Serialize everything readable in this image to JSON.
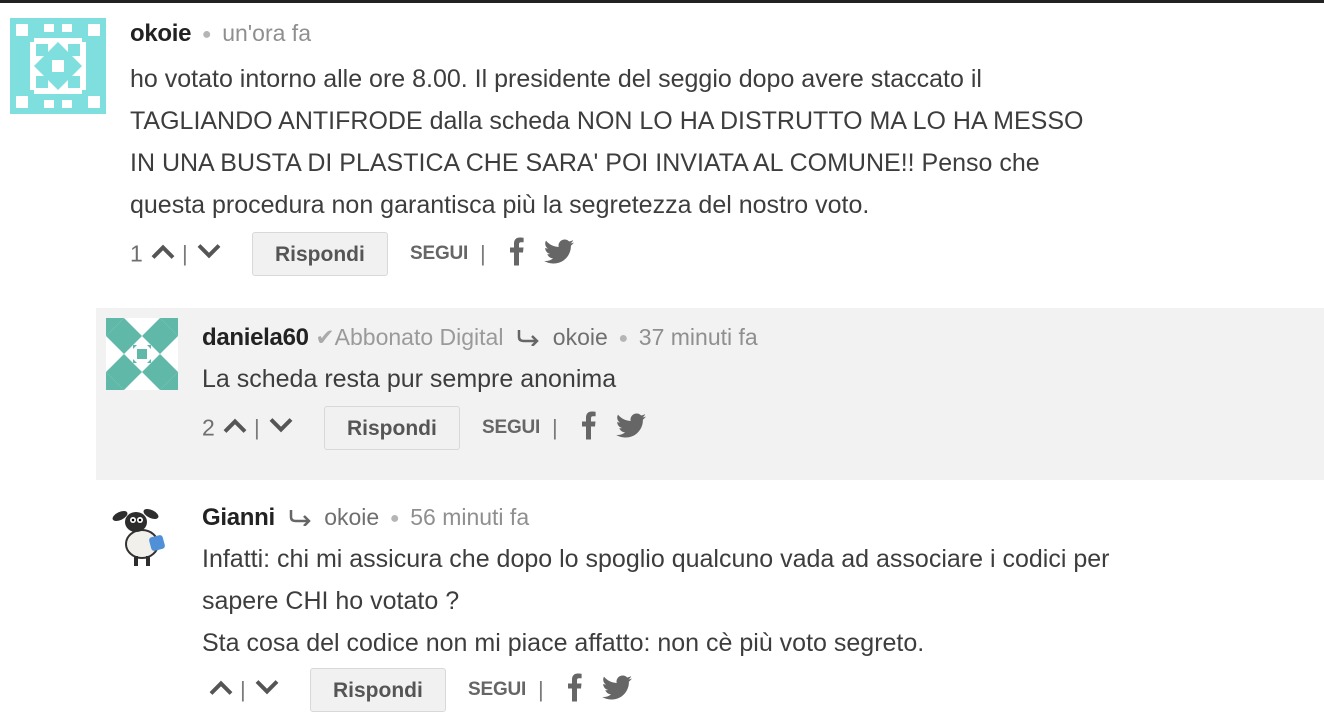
{
  "comments": [
    {
      "author": "okoie",
      "time": "un'ora fa",
      "lines": [
        "ho votato intorno alle ore 8.00. Il presidente del seggio dopo avere staccato il",
        "TAGLIANDO ANTIFRODE dalla scheda NON LO HA DISTRUTTO MA LO HA MESSO",
        "IN UNA BUSTA DI PLASTICA CHE SARA' POI INVIATA AL COMUNE!! Penso che",
        "questa procedura non garantisca più la segretezza del nostro voto."
      ],
      "votes": "1",
      "reply_label": "Rispondi",
      "follow_label": "SEGUI",
      "avatar_color": "#7fdede"
    },
    {
      "author": "daniela60",
      "badge": "Abbonato Digital",
      "reply_to": "okoie",
      "time": "37 minuti fa",
      "lines": [
        "La scheda resta pur sempre anonima"
      ],
      "votes": "2",
      "reply_label": "Rispondi",
      "follow_label": "SEGUI",
      "avatar_color": "#5fb8a8"
    },
    {
      "author": "Gianni",
      "reply_to": "okoie",
      "time": "56 minuti fa",
      "lines": [
        "Infatti: chi mi assicura che dopo lo spoglio qualcuno vada ad associare i codici per",
        "sapere CHI ho votato ?",
        "Sta cosa del codice non mi piace affatto: non cè più voto segreto."
      ],
      "votes": "",
      "reply_label": "Rispondi",
      "follow_label": "SEGUI"
    }
  ],
  "colors": {
    "reply_background": "#f2f2f2",
    "text": "#3d3d3d",
    "meta": "#8f8f8f"
  },
  "icons": [
    "upvote-chevron-icon",
    "downvote-chevron-icon",
    "facebook-icon",
    "twitter-icon",
    "reply-arrow-icon",
    "verified-check-icon"
  ]
}
